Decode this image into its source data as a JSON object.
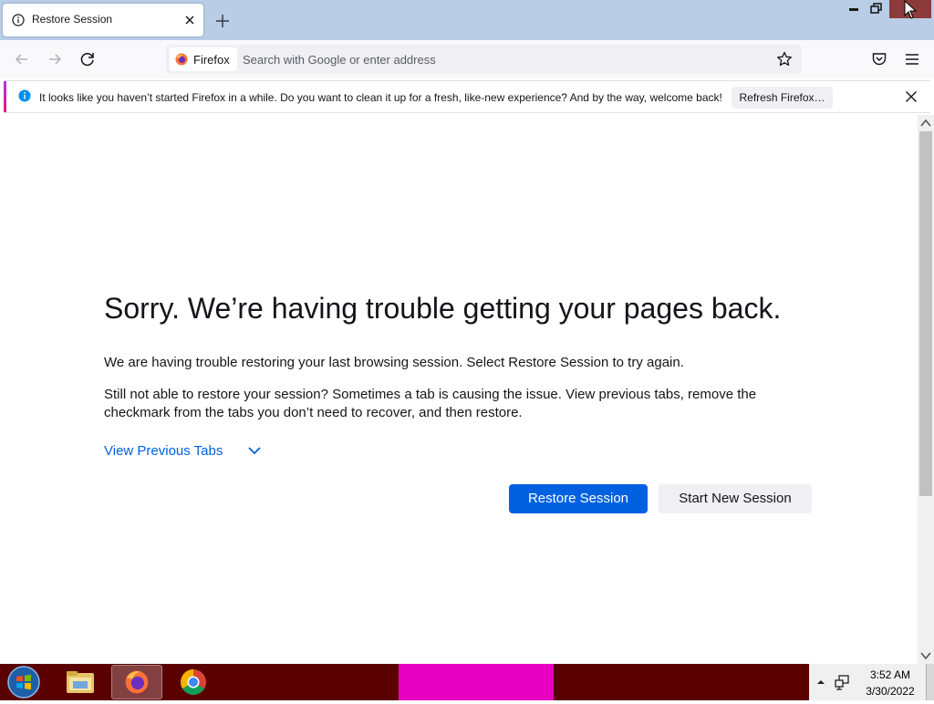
{
  "tab": {
    "title": "Restore Session",
    "icon": "info-icon"
  },
  "navbar": {
    "identity_label": "Firefox",
    "search_placeholder": "Search with Google or enter address",
    "search_value": ""
  },
  "notification": {
    "message": "It looks like you haven’t started Firefox in a while. Do you want to clean it up for a fresh, like-new experience? And by the way, welcome back!",
    "button_label": "Refresh Firefox…"
  },
  "main": {
    "title": "Sorry. We’re having trouble getting your pages back.",
    "paragraph_1": "We are having trouble restoring your last browsing session. Select Restore Session to try again.",
    "paragraph_2": "Still not able to restore your session? Sometimes a tab is causing the issue. View previous tabs, remove the checkmark from the tabs you don’t need to recover, and then restore.",
    "view_tabs_label": "View Previous Tabs",
    "restore_label": "Restore Session",
    "new_session_label": "Start New Session"
  },
  "taskbar": {
    "apps": [
      "windows-explorer",
      "firefox",
      "chrome"
    ],
    "clock_time": "3:52 AM",
    "clock_date": "3/30/2022"
  },
  "colors": {
    "accent": "#0061e0",
    "tabstrip": "#b9cde6",
    "taskbar": "#5a0000",
    "taskbar_highlight": "#e800c0"
  }
}
